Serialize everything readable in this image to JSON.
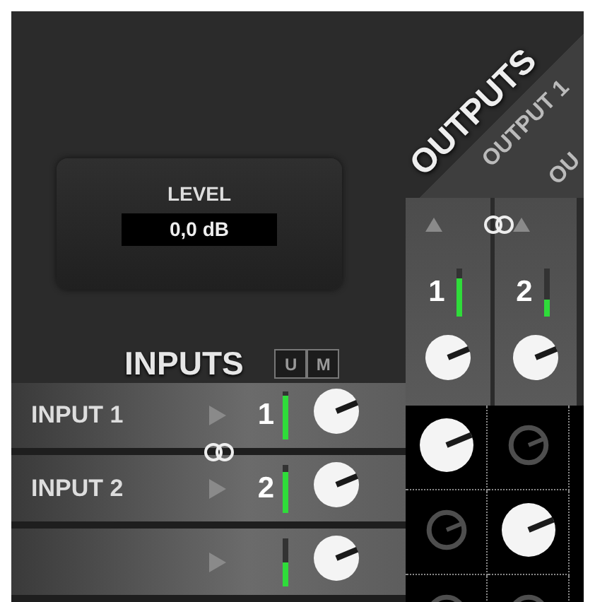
{
  "level_display": {
    "label": "LEVEL",
    "value": "0,0 dB"
  },
  "outputs": {
    "header": "OUTPUTS",
    "labels": [
      "OUTPUT 1",
      "OU"
    ],
    "linked": true,
    "channels": [
      {
        "number": "1",
        "meter": {
          "level": 0.8
        }
      },
      {
        "number": "2",
        "meter": {
          "level": 0.35
        }
      }
    ]
  },
  "inputs": {
    "header": "INPUTS",
    "buttons": [
      "U",
      "M"
    ],
    "linked": true,
    "channels": [
      {
        "name": "INPUT 1",
        "number": "1",
        "meter": {
          "level": 0.9
        }
      },
      {
        "name": "INPUT 2",
        "number": "2",
        "meter": {
          "level": 0.85
        }
      },
      {
        "meter": {
          "level": 0.5
        }
      }
    ]
  },
  "matrix": [
    [
      {
        "on": true
      },
      {
        "on": false
      }
    ],
    [
      {
        "on": false
      },
      {
        "on": true
      }
    ],
    [
      {
        "on": false
      },
      {
        "on": false
      }
    ]
  ]
}
